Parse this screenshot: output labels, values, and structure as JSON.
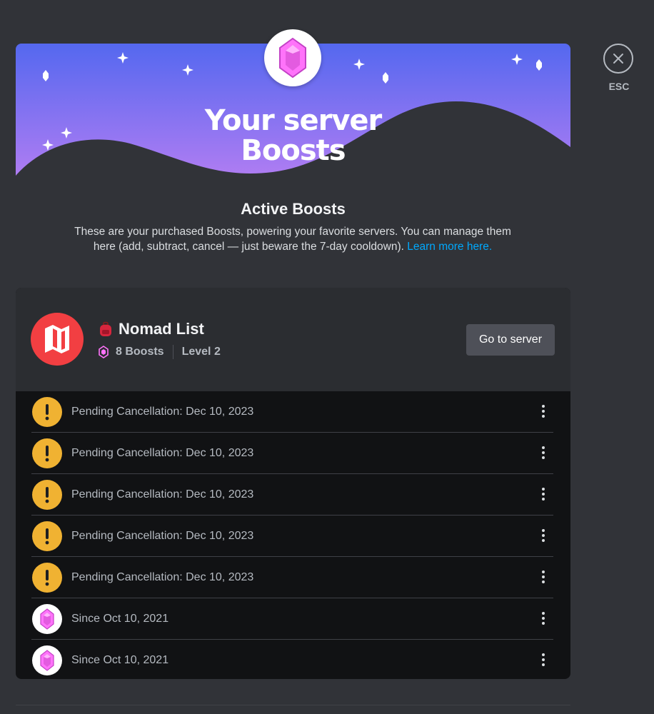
{
  "header": {
    "title_line1": "Your server",
    "title_line2": "Boosts",
    "close_label": "ESC"
  },
  "intro": {
    "title": "Active Boosts",
    "description": "These are your purchased Boosts, powering your favorite servers. You can manage them here (add, subtract, cancel — just beware the 7-day cooldown).",
    "link_text": "Learn more here."
  },
  "server": {
    "name": "Nomad List",
    "emoji_icon": "backpack-icon",
    "boosts": "8 Boosts",
    "level": "Level 2",
    "go_button": "Go to server"
  },
  "boosts": [
    {
      "status": "pending",
      "icon": "warning-icon",
      "text": "Pending Cancellation: Dec 10, 2023"
    },
    {
      "status": "pending",
      "icon": "warning-icon",
      "text": "Pending Cancellation: Dec 10, 2023"
    },
    {
      "status": "pending",
      "icon": "warning-icon",
      "text": "Pending Cancellation: Dec 10, 2023"
    },
    {
      "status": "pending",
      "icon": "warning-icon",
      "text": "Pending Cancellation: Dec 10, 2023"
    },
    {
      "status": "pending",
      "icon": "warning-icon",
      "text": "Pending Cancellation: Dec 10, 2023"
    },
    {
      "status": "active",
      "icon": "boost-gem-icon",
      "text": "Since Oct 10, 2021"
    },
    {
      "status": "active",
      "icon": "boost-gem-icon",
      "text": "Since Oct 10, 2021"
    }
  ],
  "colors": {
    "background": "#313338",
    "card": "#111214",
    "card_header": "#2b2d31",
    "link": "#00a8fc",
    "warning": "#f0b232",
    "server_icon": "#f23f42",
    "boost_pink": "#ff73fa",
    "banner_top": "#5865f2",
    "banner_bottom": "#b473f5"
  }
}
